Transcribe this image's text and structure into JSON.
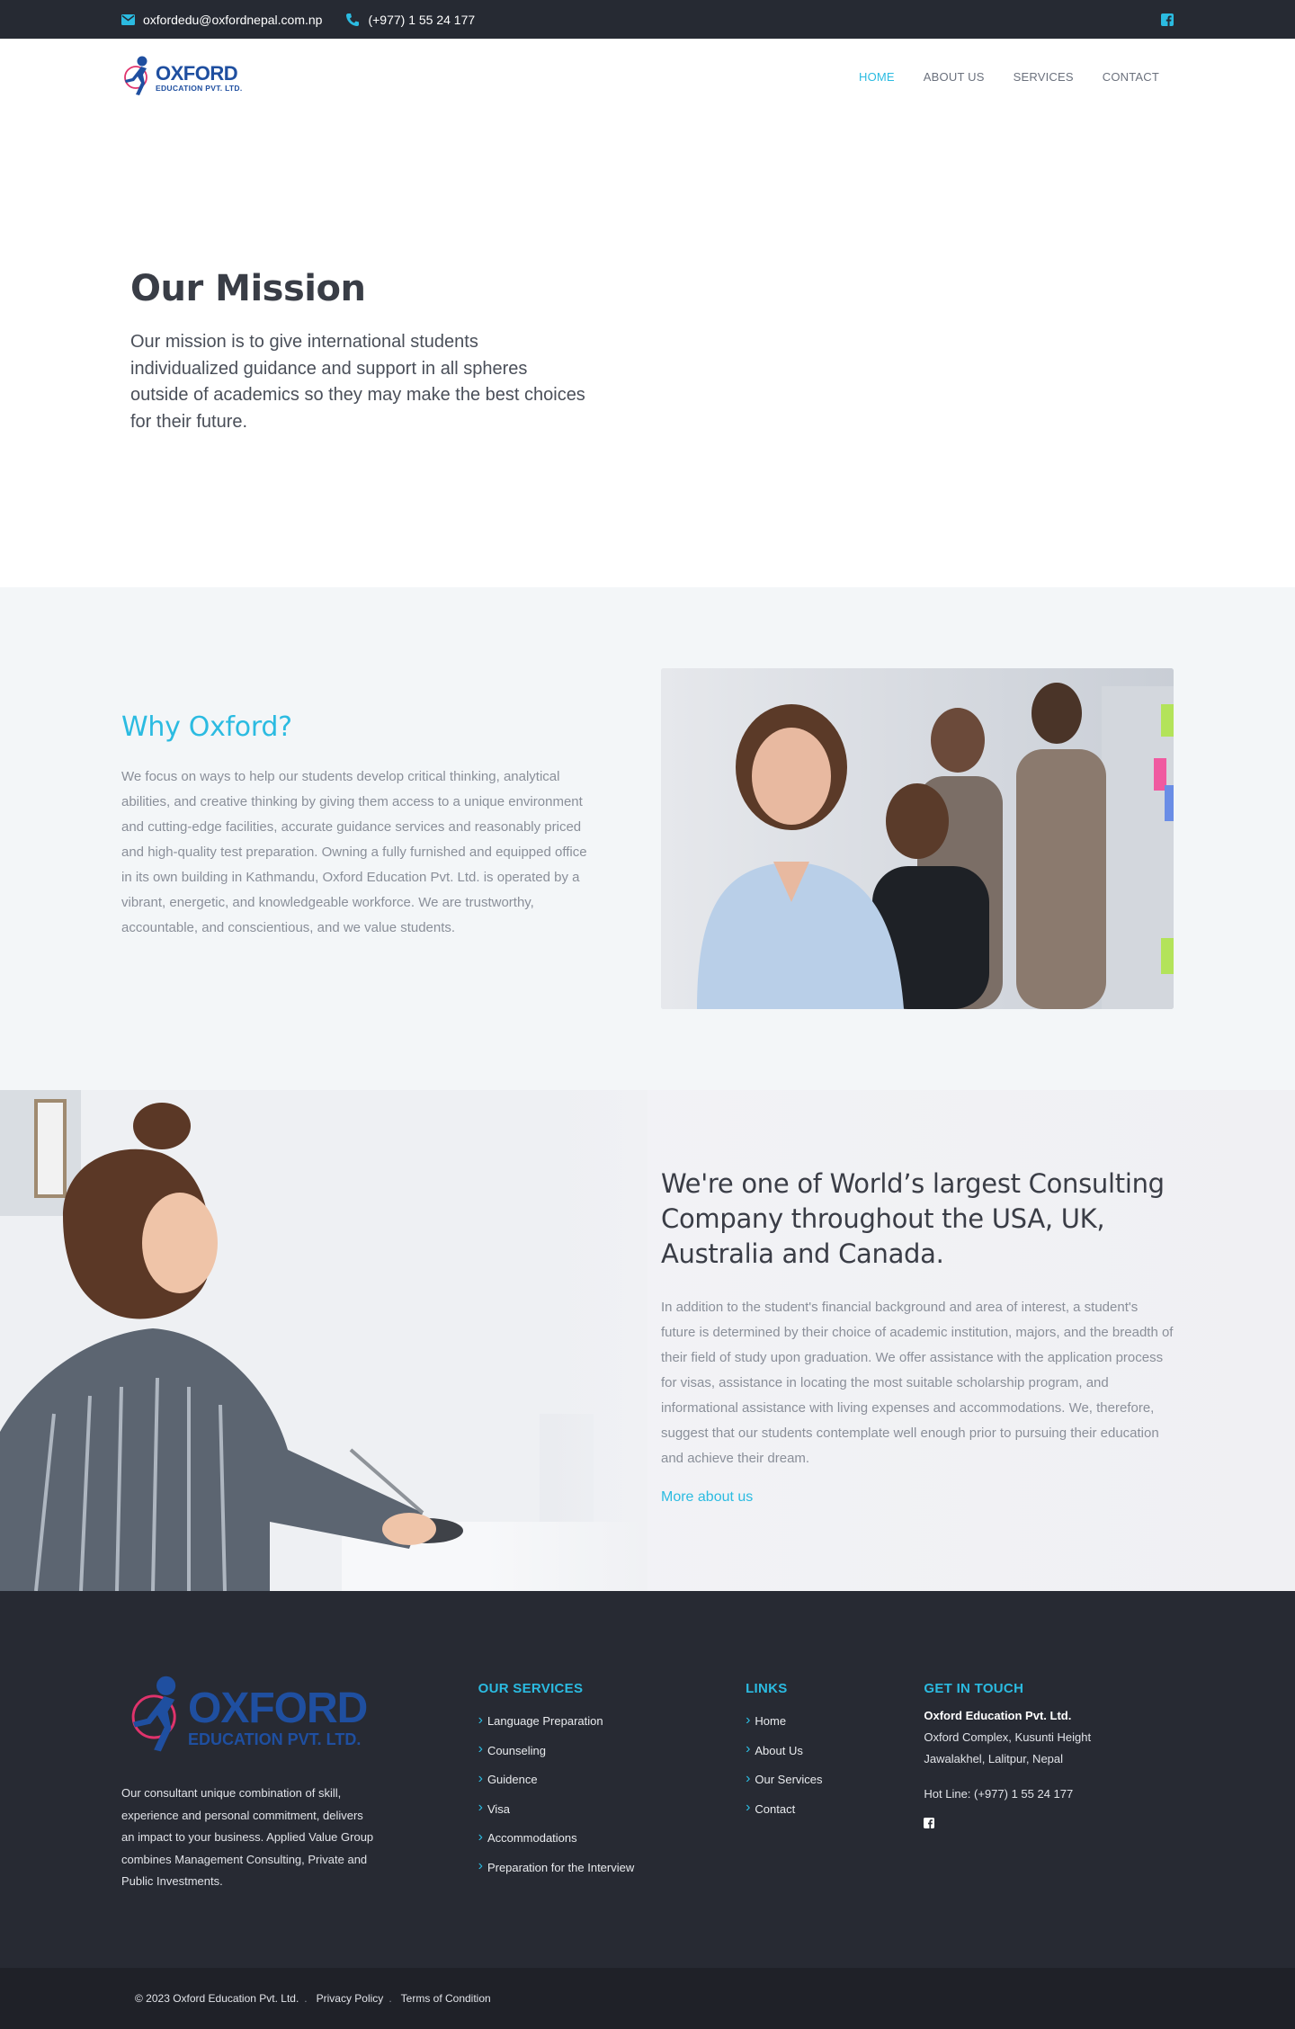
{
  "topbar": {
    "email": "oxfordedu@oxfordnepal.com.np",
    "phone": "(+977) 1 55 24 177",
    "email_icon": "envelope-icon",
    "phone_icon": "phone-icon",
    "social_icon": "facebook-icon"
  },
  "header": {
    "logo_title": "OXFORD",
    "logo_subtitle": "EDUCATION PVT. LTD.",
    "nav": [
      {
        "label": "HOME",
        "active": true
      },
      {
        "label": "ABOUT US",
        "active": false
      },
      {
        "label": "SERVICES",
        "active": false
      },
      {
        "label": "CONTACT",
        "active": false
      }
    ]
  },
  "mission": {
    "title": "Our Mission",
    "text": "Our mission is to give international students individualized guidance and support in all spheres outside of academics so they may make the best choices for their future."
  },
  "why": {
    "title": "Why Oxford?",
    "text": "We focus on ways to help our students develop critical thinking, analytical abilities, and creative thinking by giving them access to a unique environment and cutting-edge facilities, accurate guidance services and reasonably priced and high-quality test preparation. Owning a fully furnished and equipped office in its own building in Kathmandu, Oxford Education Pvt. Ltd. is operated by a vibrant, energetic, and knowledgeable workforce. We are trustworthy, accountable, and conscientious, and we value students."
  },
  "largest": {
    "title": "We're one of World’s largest Consulting Company throughout the USA, UK, Australia and Canada.",
    "text": "In addition to the student's financial background and area of interest, a student's future is determined by their choice of academic institution, majors, and the breadth of their field of study upon graduation. We offer assistance with the application process for visas, assistance in locating the most suitable scholarship program, and informational assistance with living expenses and accommodations. We, therefore, suggest that our students contemplate well enough prior to pursuing their education and achieve their dream.",
    "link": "More about us"
  },
  "footer": {
    "logo_title": "OXFORD",
    "logo_subtitle": "EDUCATION PVT. LTD.",
    "about": "Our consultant unique combination of skill, experience and personal commitment, delivers an impact to your business. Applied Value Group combines Management Consulting, Private and Public Investments.",
    "services_title": "OUR SERVICES",
    "services": [
      "Language Preparation",
      "Counseling",
      "Guidence",
      "Visa",
      "Accommodations",
      "Preparation for the Interview"
    ],
    "links_title": "LINKS",
    "links": [
      "Home",
      "About Us",
      "Our Services",
      "Contact"
    ],
    "contact_title": "GET IN TOUCH",
    "company": "Oxford Education Pvt. Ltd.",
    "address_line1": "Oxford Complex, Kusunti Height",
    "address_line2": "Jawalakhel, Lalitpur, Nepal",
    "hotline": "Hot Line: (+977) 1 55 24 177",
    "social_icon": "facebook-icon"
  },
  "bottom": {
    "copyright": "© 2023 Oxford Education Pvt. Ltd.",
    "privacy": "Privacy Policy",
    "terms": "Terms of Condition",
    "separator": "."
  },
  "colors": {
    "accent": "#2bbbe1",
    "dark": "#262a33",
    "brand_blue": "#1f4fa0",
    "brand_pink": "#e0336c"
  }
}
